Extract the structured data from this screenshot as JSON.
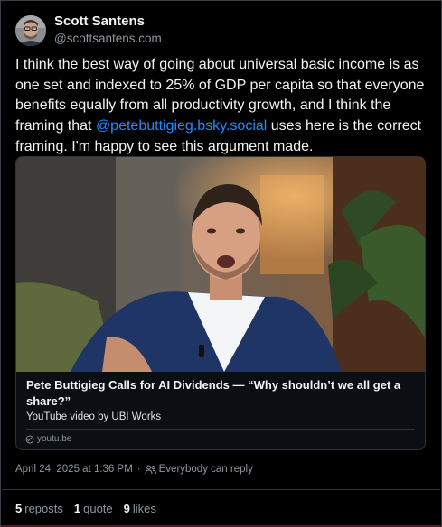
{
  "author": {
    "display_name": "Scott Santens",
    "handle": "@scottsantens.com"
  },
  "post": {
    "text_before": "I think the best way of going about universal basic income is as one set and indexed to 25% of GDP per capita so that everyone benefits equally from all productivity growth, and I think the framing that ",
    "mention": "@petebuttigieg.bsky.social",
    "text_after": " uses here is the correct framing. I'm happy to see this argument made."
  },
  "embed": {
    "title": "Pete Buttigieg Calls for AI Dividends — “Why shouldn’t we all get a share?”",
    "description": "YouTube video by UBI Works",
    "domain": "youtu.be"
  },
  "meta": {
    "timestamp": "April 24, 2025 at 1:36 PM",
    "separator": "·",
    "reply_setting": "Everybody can reply"
  },
  "stats": {
    "reposts_count": "5",
    "reposts_label": "reposts",
    "quotes_count": "1",
    "quotes_label": "quote",
    "likes_count": "9",
    "likes_label": "likes"
  },
  "colors": {
    "background": "#000000",
    "text": "#f1f3f5",
    "muted": "#8d96a0",
    "link": "#208bfe",
    "border": "#2e3338"
  }
}
